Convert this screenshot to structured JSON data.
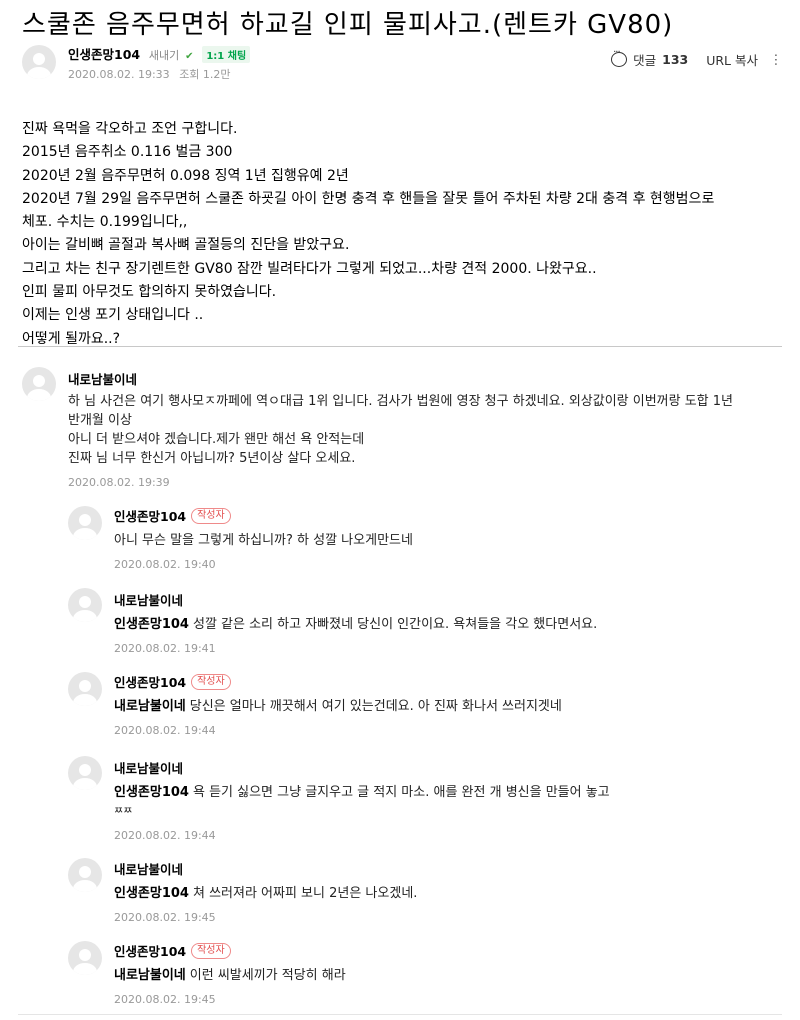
{
  "post": {
    "title": "스쿨존 음주무면허 하교길 인피 물피사고.(렌트카 GV80)",
    "author": "인생존망104",
    "grade": "새내기",
    "chat_badge": "1:1 채팅",
    "date": "2020.08.02. 19:33",
    "views": "조회 1.2만",
    "comment_label": "댓글",
    "comment_count": "133",
    "url_copy": "URL 복사",
    "body_lines": [
      "진짜 욕먹을 각오하고 조언 구합니다.",
      "2015년 음주취소 0.116 벌금 300",
      "2020년 2월 음주무면허 0.098 징역 1년 집행유예 2년",
      "2020년 7월 29일 음주무면허 스쿨존 하굣길 아이 한명 충격 후 핸들을 잘못 틀어 주차된 차량 2대 충격 후 현행범으로",
      "체포. 수치는 0.199입니다,,",
      "아이는 갈비뼈 골절과 복사뼈 골절등의 진단을 받았구요.",
      "그리고 차는 친구 장기렌트한 GV80 잠깐 빌려타다가 그렇게 되었고...차량 견적 2000. 나왔구요..",
      "인피 물피 아무것도 합의하지 못하였습니다.",
      "이제는 인생 포기 상태입니다 ..",
      "어떻게 될까요..?"
    ]
  },
  "comments": [
    {
      "name": "내로남불이네",
      "is_writer": false,
      "mention": "",
      "lines": [
        "하 님 사건은 여기 행사모ㅈ까페에 역ㅇ대급 1위 입니다. 검사가 법원에 영장 청구 하겠네요. 외상값이랑 이번꺼랑 도합 1년",
        "반개월 이상",
        "아니 더 받으셔야 겠습니다.제가 왠만 해선 욕 안적는데",
        "진짜 님 너무 한신거 아닙니까? 5년이상 살다 오세요."
      ],
      "date": "2020.08.02. 19:39"
    },
    {
      "name": "인생존망104",
      "is_writer": true,
      "mention": "",
      "lines": [
        "아니 무슨 말을 그렇게 하십니까? 하 성깔 나오게만드네"
      ],
      "date": "2020.08.02. 19:40"
    },
    {
      "name": "내로남불이네",
      "is_writer": false,
      "mention": "인생존망104",
      "lines": [
        "성깔 같은 소리 하고 자빠졌네 당신이 인간이요. 욕쳐들을 각오 했다면서요."
      ],
      "date": "2020.08.02. 19:41"
    },
    {
      "name": "인생존망104",
      "is_writer": true,
      "mention": "내로남불이네",
      "lines": [
        "당신은 얼마나 깨끗해서 여기 있는건데요. 아 진짜 화나서 쓰러지겟네"
      ],
      "date": "2020.08.02. 19:44"
    },
    {
      "name": "내로남불이네",
      "is_writer": false,
      "mention": "인생존망104",
      "lines": [
        "욕 듣기 싫으면 그냥 글지우고 글 적지 마소. 애를 완전 개 병신을 만들어 놓고",
        "ㅉㅉ"
      ],
      "date": "2020.08.02. 19:44"
    },
    {
      "name": "내로남불이네",
      "is_writer": false,
      "mention": "인생존망104",
      "lines": [
        "쳐 쓰러져라 어짜피 보니 2년은 나오겠네."
      ],
      "date": "2020.08.02. 19:45"
    },
    {
      "name": "인생존망104",
      "is_writer": true,
      "mention": "내로남불이네",
      "lines": [
        "이런 씨발세끼가 적당히 해라"
      ],
      "date": "2020.08.02. 19:45"
    }
  ],
  "writer_badge_label": "작성자"
}
